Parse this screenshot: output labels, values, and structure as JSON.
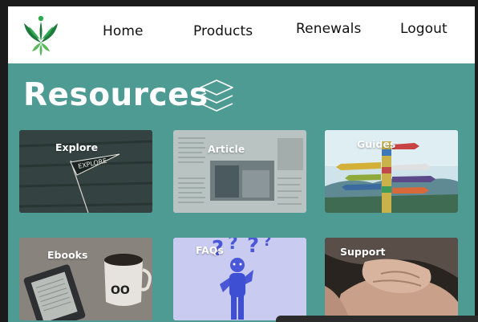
{
  "header": {
    "logo_icon": "plant-hands-logo-icon",
    "nav": [
      {
        "label": "Home"
      },
      {
        "label": "Products"
      },
      {
        "label": "Renewals"
      },
      {
        "label": "Logout"
      }
    ]
  },
  "main": {
    "title": "Resources",
    "title_icon": "layers-icon",
    "background_color": "#4e9b94",
    "cards": [
      {
        "label": "Explore",
        "image": "explore-pennant-image"
      },
      {
        "label": "Article",
        "image": "newspaper-image"
      },
      {
        "label": "Guides",
        "image": "signpost-image"
      },
      {
        "label": "Ebooks",
        "image": "ereader-and-mug-image"
      },
      {
        "label": "FAQs",
        "image": "question-figure-image"
      },
      {
        "label": "Support",
        "image": "holding-hands-image"
      }
    ]
  },
  "colors": {
    "brand_green": "#1f7a3c",
    "accent_leaf": "#5cb85c",
    "teal_background": "#4e9b94"
  }
}
